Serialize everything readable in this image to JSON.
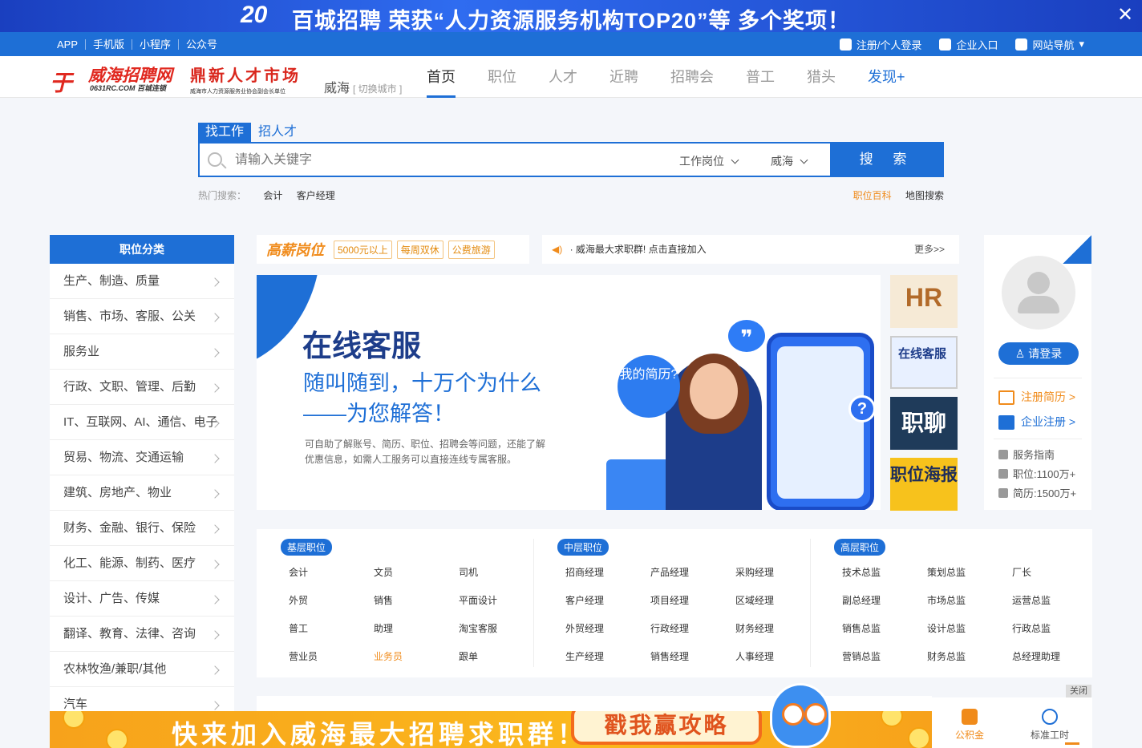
{
  "top_banner": {
    "number": "20",
    "text": "百城招聘 荣获“人力资源服务机构TOP20”等 多个奖项！",
    "close": "✕"
  },
  "topbar": {
    "links": [
      "APP",
      "手机版",
      "小程序",
      "公众号"
    ],
    "register": "注册/个人登录",
    "company": "企业入口",
    "sitenav": "网站导航"
  },
  "header": {
    "logo_title": "威海招聘网",
    "logo_sub": "0631RC.COM 百城连锁",
    "logo2_title": "鼎新人才市场",
    "logo2_sub": "威海市人力资源服务业协会副会长单位",
    "city": "威海",
    "switch_city": "[ 切换城市 ]",
    "nav": [
      "首页",
      "职位",
      "人才",
      "近聘",
      "招聘会",
      "普工",
      "猎头",
      "发现+"
    ]
  },
  "search": {
    "tabs": [
      "找工作",
      "招人才"
    ],
    "placeholder": "请输入关键字",
    "type_select": "工作岗位",
    "city_select": "威海",
    "button": "搜 索",
    "hot_label": "热门搜索：",
    "hot": [
      "会计",
      "客户经理"
    ],
    "right_links": [
      "职位百科",
      "地图搜索"
    ]
  },
  "sidebar": {
    "title": "职位分类",
    "items": [
      "生产、制造、质量",
      "销售、市场、客服、公关",
      "服务业",
      "行政、文职、管理、后勤",
      "IT、互联网、AI、通信、电子",
      "贸易、物流、交通运输",
      "建筑、房地产、物业",
      "财务、金融、银行、保险",
      "化工、能源、制药、医疗",
      "设计、广告、传媒",
      "翻译、教育、法律、咨询",
      "农林牧渔/兼职/其他",
      "汽车"
    ]
  },
  "highsalary": {
    "logo": "高薪岗位",
    "tags": [
      "5000元以上",
      "每周双休",
      "公费旅游"
    ]
  },
  "notice": {
    "text": "· 威海最大求职群! 点击直接加入",
    "more": "更多>>"
  },
  "slider": {
    "title": "在线客服",
    "line1": "随叫随到，十万个为什么",
    "line2": "——为您解答！",
    "desc1": "可自助了解账号、简历、职位、招聘会等问题，还能了解",
    "desc2": "优惠信息，如需人工服务可以直接连线专属客服。",
    "bubble": "我的简历?"
  },
  "thumbs": [
    "HR",
    "在线客服",
    "职聊",
    "职位海报"
  ],
  "user": {
    "login": "请登录",
    "reg_resume": "注册简历 >",
    "reg_company": "企业注册 >",
    "guide": "服务指南",
    "jobs": "职位:1100万+",
    "resumes": "简历:1500万+"
  },
  "jobs": [
    {
      "label": "基层职位",
      "items": [
        "会计",
        "文员",
        "司机",
        "外贸",
        "销售",
        "平面设计",
        "普工",
        "助理",
        "淘宝客服",
        "营业员",
        "业务员",
        "跟单"
      ]
    },
    {
      "label": "中层职位",
      "items": [
        "招商经理",
        "产品经理",
        "采购经理",
        "客户经理",
        "项目经理",
        "区域经理",
        "外贸经理",
        "行政经理",
        "财务经理",
        "生产经理",
        "销售经理",
        "人事经理"
      ]
    },
    {
      "label": "高层职位",
      "items": [
        "技术总监",
        "策划总监",
        "厂长",
        "副总经理",
        "市场总监",
        "运营总监",
        "销售总监",
        "设计总监",
        "行政总监",
        "营销总监",
        "财务总监",
        "总经理助理"
      ]
    }
  ],
  "bottom_banner": {
    "text": "快来加入威海最大招聘求职群！",
    "button": "戳我赢攻略",
    "close": "关闭"
  },
  "quick": [
    "公积金",
    "标准工时"
  ]
}
